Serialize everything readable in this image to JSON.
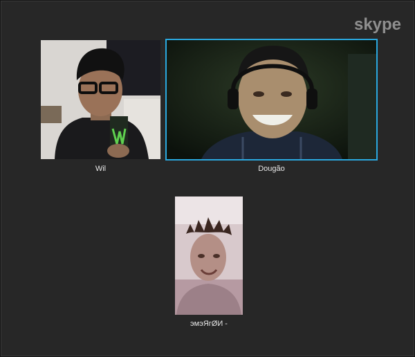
{
  "app": {
    "name": "Skype",
    "logo_text": "skype",
    "icon": "skype-logo",
    "accent_color": "#2aa9e0",
    "background_color": "#272727"
  },
  "call": {
    "participants": [
      {
        "name": "Wil",
        "active_speaker": false
      },
      {
        "name": "Dougão",
        "active_speaker": true
      },
      {
        "name": "эмэЯгØИ -",
        "active_speaker": false
      }
    ]
  }
}
